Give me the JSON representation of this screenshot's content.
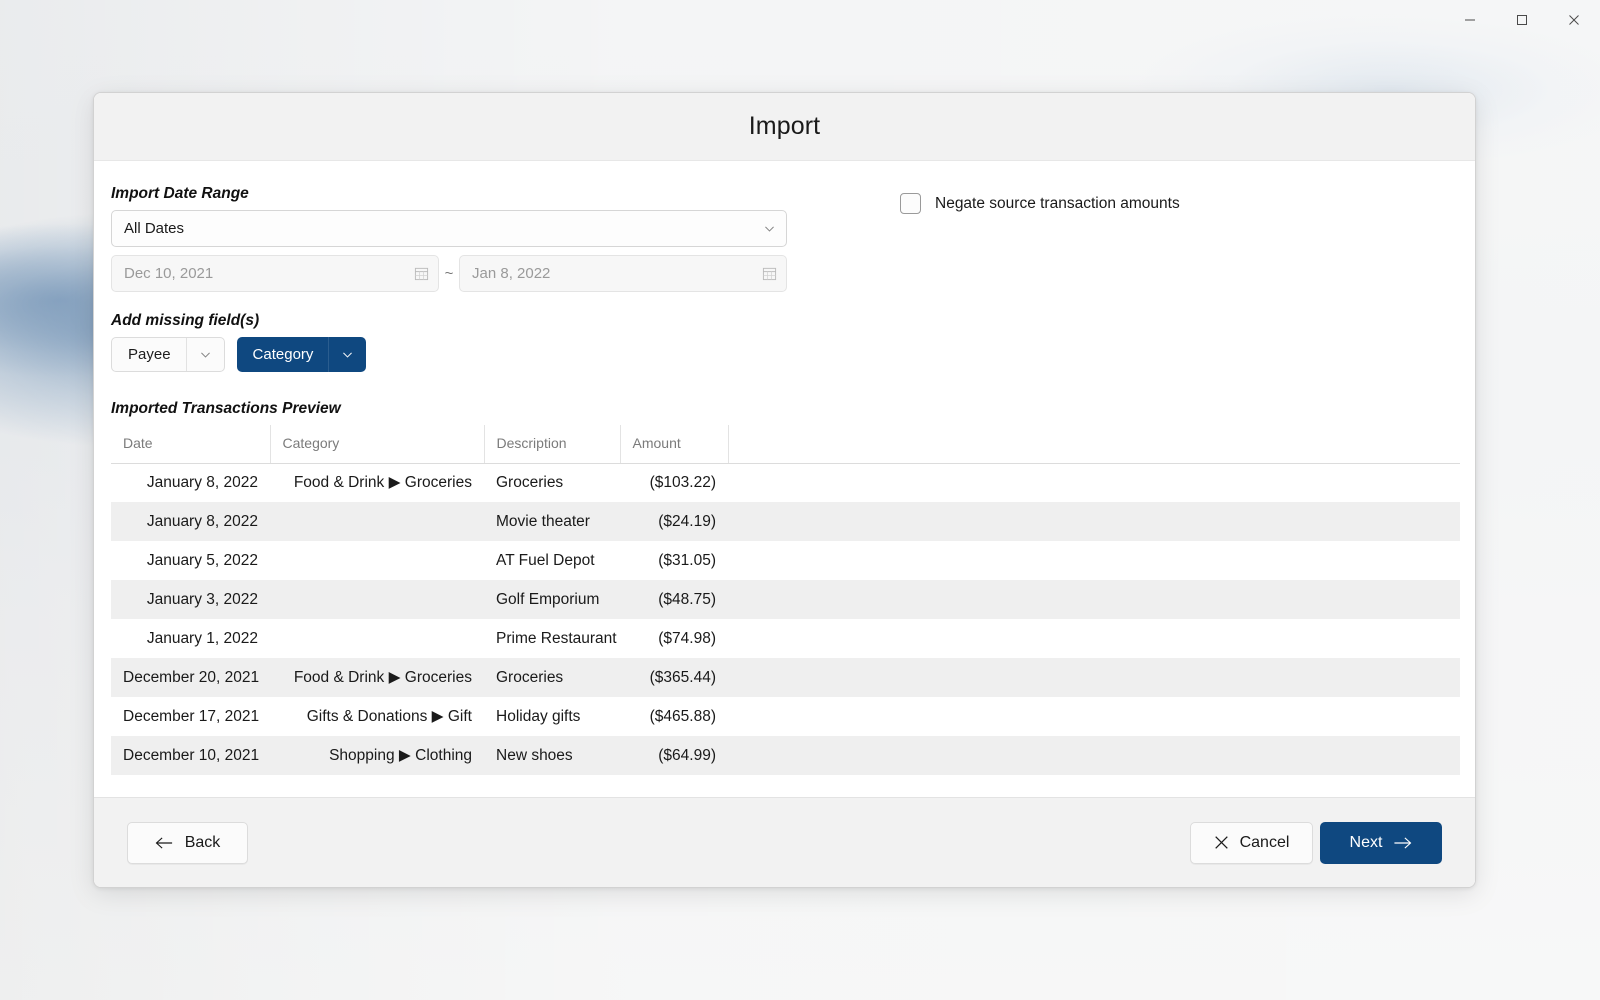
{
  "window": {
    "controls": [
      {
        "name": "minimize",
        "glyph": "minimize-icon"
      },
      {
        "name": "maximize",
        "glyph": "maximize-icon"
      },
      {
        "name": "close",
        "glyph": "close-icon"
      }
    ]
  },
  "dialog": {
    "title": "Import",
    "date_range": {
      "label": "Import Date Range",
      "select_value": "All Dates",
      "start_date": "Dec 10, 2021",
      "end_date": "Jan 8, 2022",
      "separator": "~"
    },
    "negate_checkbox": {
      "label": "Negate source transaction amounts",
      "checked": false
    },
    "missing_fields": {
      "label": "Add missing field(s)",
      "options": [
        {
          "label": "Payee",
          "selected": false
        },
        {
          "label": "Category",
          "selected": true
        }
      ]
    },
    "preview": {
      "label": "Imported Transactions Preview",
      "columns": [
        "Date",
        "Category",
        "Description",
        "Amount",
        ""
      ],
      "rows": [
        {
          "date": "January 8, 2022",
          "category": "Food & Drink ▶ Groceries",
          "description": "Groceries",
          "amount": "($103.22)"
        },
        {
          "date": "January 8, 2022",
          "category": "",
          "description": "Movie theater",
          "amount": "($24.19)"
        },
        {
          "date": "January 5, 2022",
          "category": "",
          "description": "AT Fuel Depot",
          "amount": "($31.05)"
        },
        {
          "date": "January 3, 2022",
          "category": "",
          "description": "Golf Emporium",
          "amount": "($48.75)"
        },
        {
          "date": "January 1, 2022",
          "category": "",
          "description": "Prime Restaurant",
          "amount": "($74.98)"
        },
        {
          "date": "December 20, 2021",
          "category": "Food & Drink ▶ Groceries",
          "description": "Groceries",
          "amount": "($365.44)"
        },
        {
          "date": "December 17, 2021",
          "category": "Gifts & Donations ▶ Gift",
          "description": "Holiday gifts",
          "amount": "($465.88)"
        },
        {
          "date": "December 10, 2021",
          "category": "Shopping ▶ Clothing",
          "description": "New shoes",
          "amount": "($64.99)"
        }
      ]
    },
    "footer": {
      "back_label": "Back",
      "cancel_label": "Cancel",
      "next_label": "Next"
    }
  },
  "colors": {
    "accent": "#0f4880",
    "dialog_header_bg": "#f2f2f2",
    "row_alt_bg": "#efefef",
    "text": "#1a1a1a",
    "muted_text": "#7b7b7b"
  }
}
